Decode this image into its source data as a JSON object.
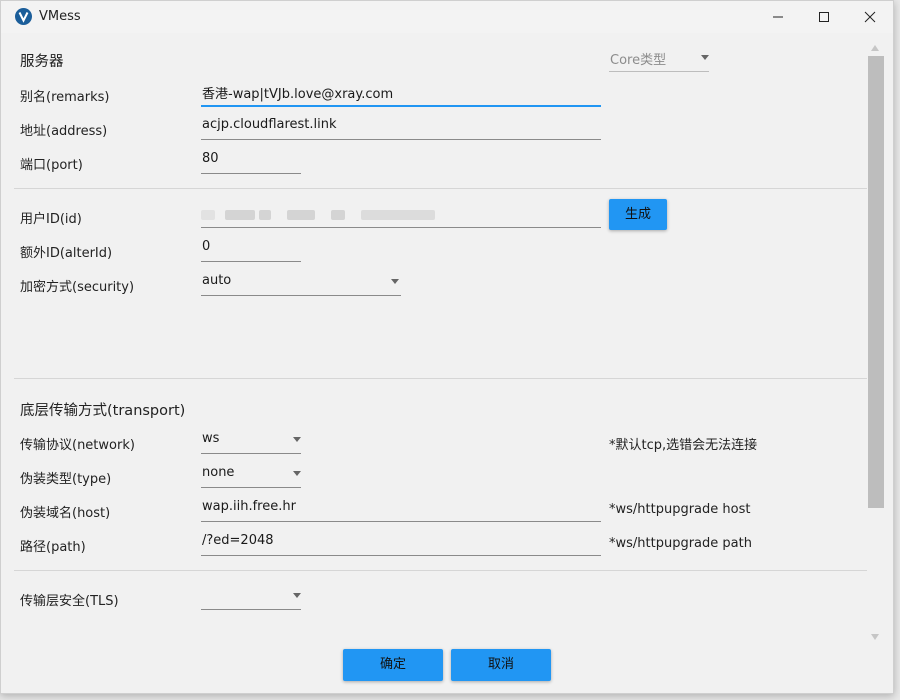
{
  "window": {
    "title": "VMess"
  },
  "server": {
    "heading": "服务器",
    "core_type_placeholder": "Core类型",
    "remarks_label": "别名(remarks)",
    "remarks_value": "香港-wap|tVJb.love@xray.com",
    "address_label": "地址(address)",
    "address_value": "acjp.cloudflarest.link",
    "port_label": "端口(port)",
    "port_value": "80",
    "userid_label": "用户ID(id)",
    "generate_label": "生成",
    "alterid_label": "额外ID(alterId)",
    "alterid_value": "0",
    "security_label": "加密方式(security)",
    "security_value": "auto"
  },
  "transport": {
    "heading": "底层传输方式(transport)",
    "network_label": "传输协议(network)",
    "network_value": "ws",
    "network_hint": "*默认tcp,选错会无法连接",
    "type_label": "伪装类型(type)",
    "type_value": "none",
    "host_label": "伪装域名(host)",
    "host_value": "wap.iih.free.hr",
    "host_hint": "*ws/httpupgrade host",
    "path_label": "路径(path)",
    "path_value": "/?ed=2048",
    "path_hint": "*ws/httpupgrade path",
    "tls_label": "传输层安全(TLS)",
    "tls_value": ""
  },
  "footer": {
    "ok_label": "确定",
    "cancel_label": "取消"
  },
  "colors": {
    "accent": "#2196f3",
    "app_icon": "#1b5e9a"
  },
  "icons": [
    "vmess-app-icon",
    "minimize-icon",
    "maximize-icon",
    "close-icon",
    "dropdown-caret-icon",
    "scroll-up-icon",
    "scroll-down-icon"
  ]
}
